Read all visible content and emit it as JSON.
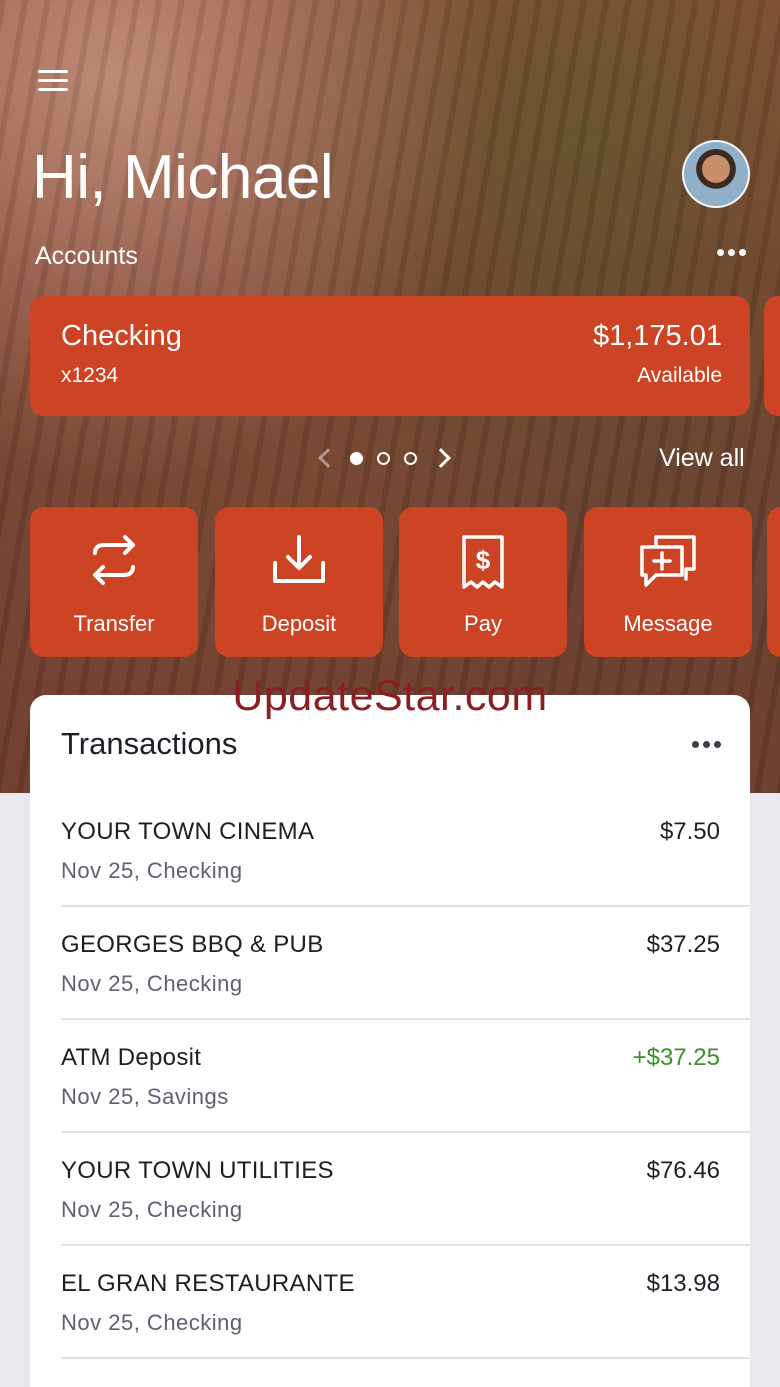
{
  "header": {
    "greeting": "Hi, Michael",
    "accounts_label": "Accounts",
    "view_all": "View all"
  },
  "account": {
    "name": "Checking",
    "number": "x1234",
    "balance": "$1,175.01",
    "balance_label": "Available"
  },
  "pager": {
    "total": 3,
    "current": 1
  },
  "actions": [
    {
      "label": "Transfer",
      "icon": "transfer-icon"
    },
    {
      "label": "Deposit",
      "icon": "deposit-icon"
    },
    {
      "label": "Pay",
      "icon": "bill-pay-icon"
    },
    {
      "label": "Message",
      "icon": "message-icon"
    }
  ],
  "watermark": "UpdateStar.com",
  "transactions": {
    "title": "Transactions",
    "items": [
      {
        "merchant": "YOUR TOWN CINEMA",
        "meta": "Nov 25, Checking",
        "amount": "$7.50",
        "credit": false
      },
      {
        "merchant": "GEORGES BBQ & PUB",
        "meta": "Nov 25, Checking",
        "amount": "$37.25",
        "credit": false
      },
      {
        "merchant": "ATM Deposit",
        "meta": "Nov 25, Savings",
        "amount": "+$37.25",
        "credit": true
      },
      {
        "merchant": "YOUR TOWN UTILITIES",
        "meta": "Nov 25, Checking",
        "amount": "$76.46",
        "credit": false
      },
      {
        "merchant": "EL GRAN RESTAURANTE",
        "meta": "Nov 25, Checking",
        "amount": "$13.98",
        "credit": false
      }
    ]
  },
  "colors": {
    "accent": "#cc4424",
    "credit": "#3e8f2a",
    "watermark": "#8a1f22"
  }
}
